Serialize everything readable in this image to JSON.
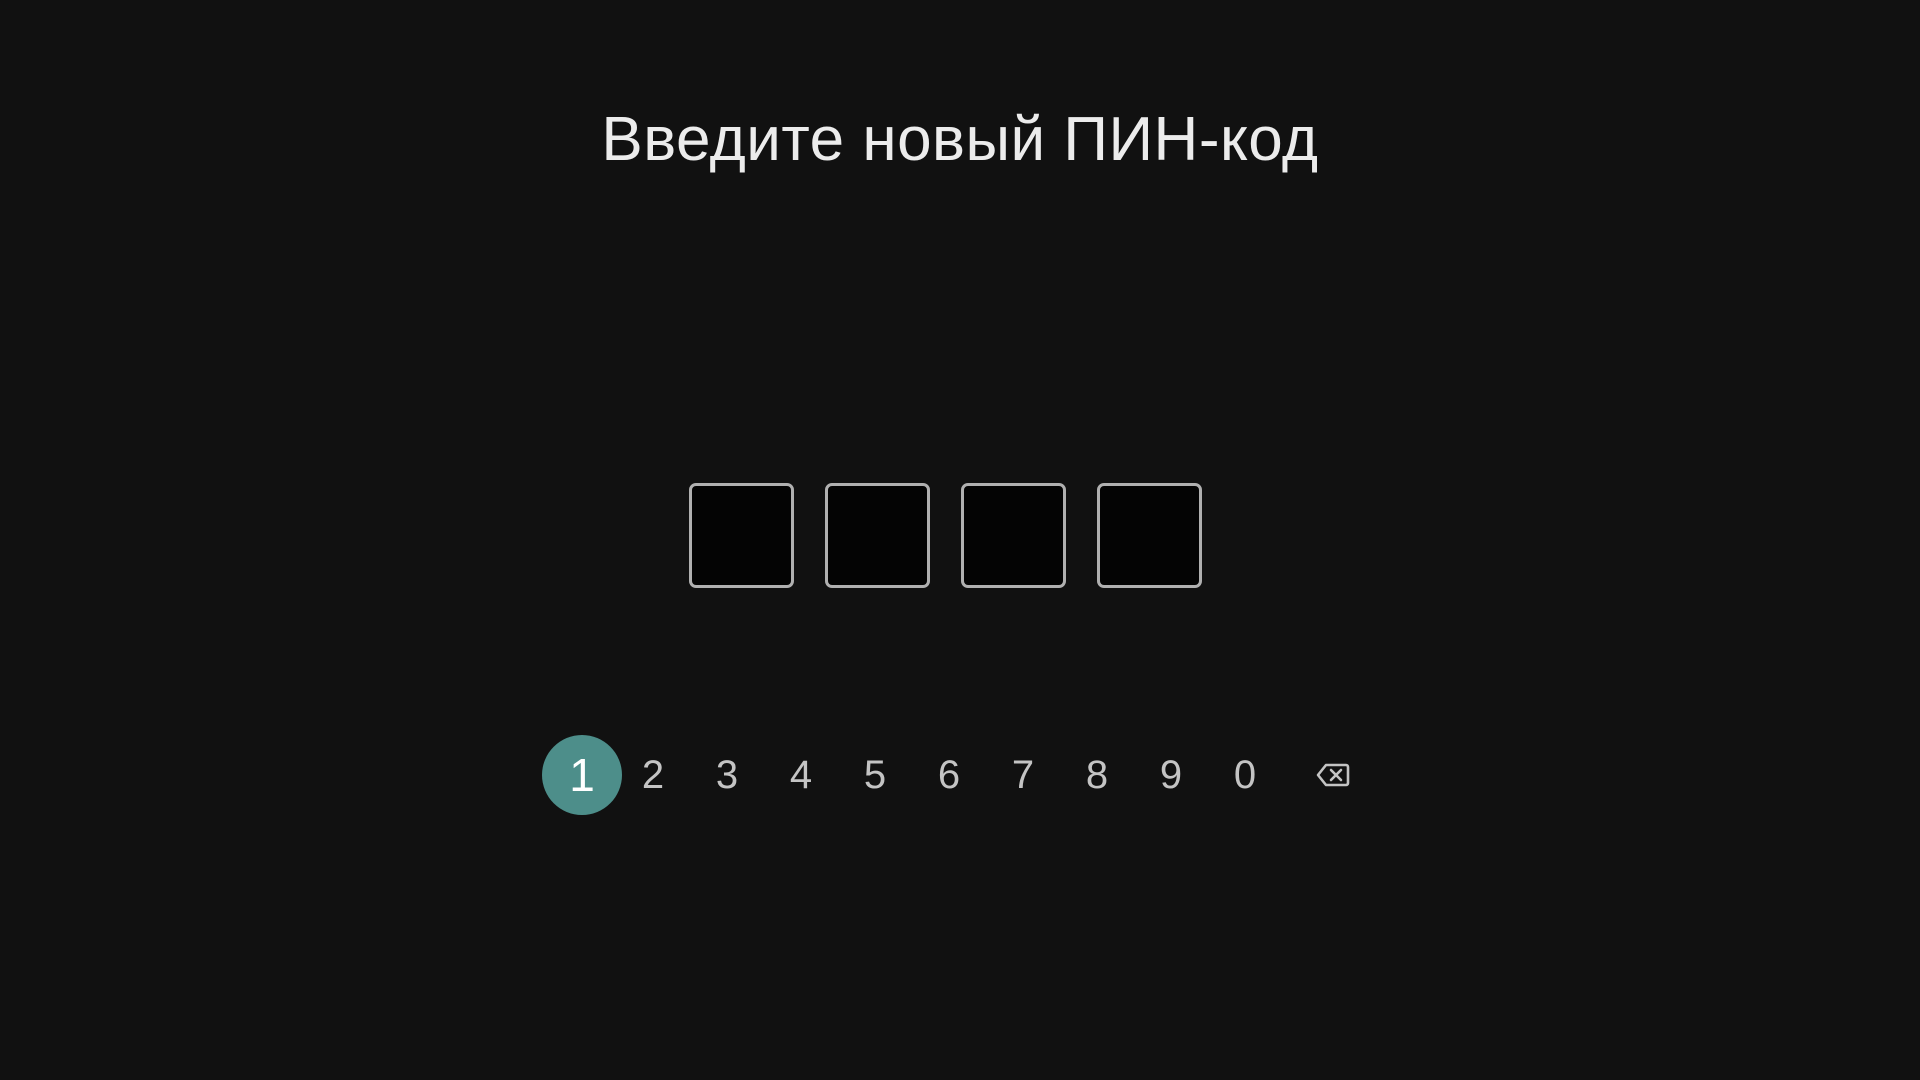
{
  "title": "Введите новый ПИН-код",
  "pin": {
    "length": 4,
    "entered_digits": 0
  },
  "keypad": {
    "keys": [
      "1",
      "2",
      "3",
      "4",
      "5",
      "6",
      "7",
      "8",
      "9",
      "0"
    ],
    "selected_key": "1",
    "backspace_icon": "backspace-icon"
  },
  "colors": {
    "background": "#111111",
    "accent": "#4d8e8a",
    "box_border": "#b0b0b0",
    "text": "#ececec"
  }
}
